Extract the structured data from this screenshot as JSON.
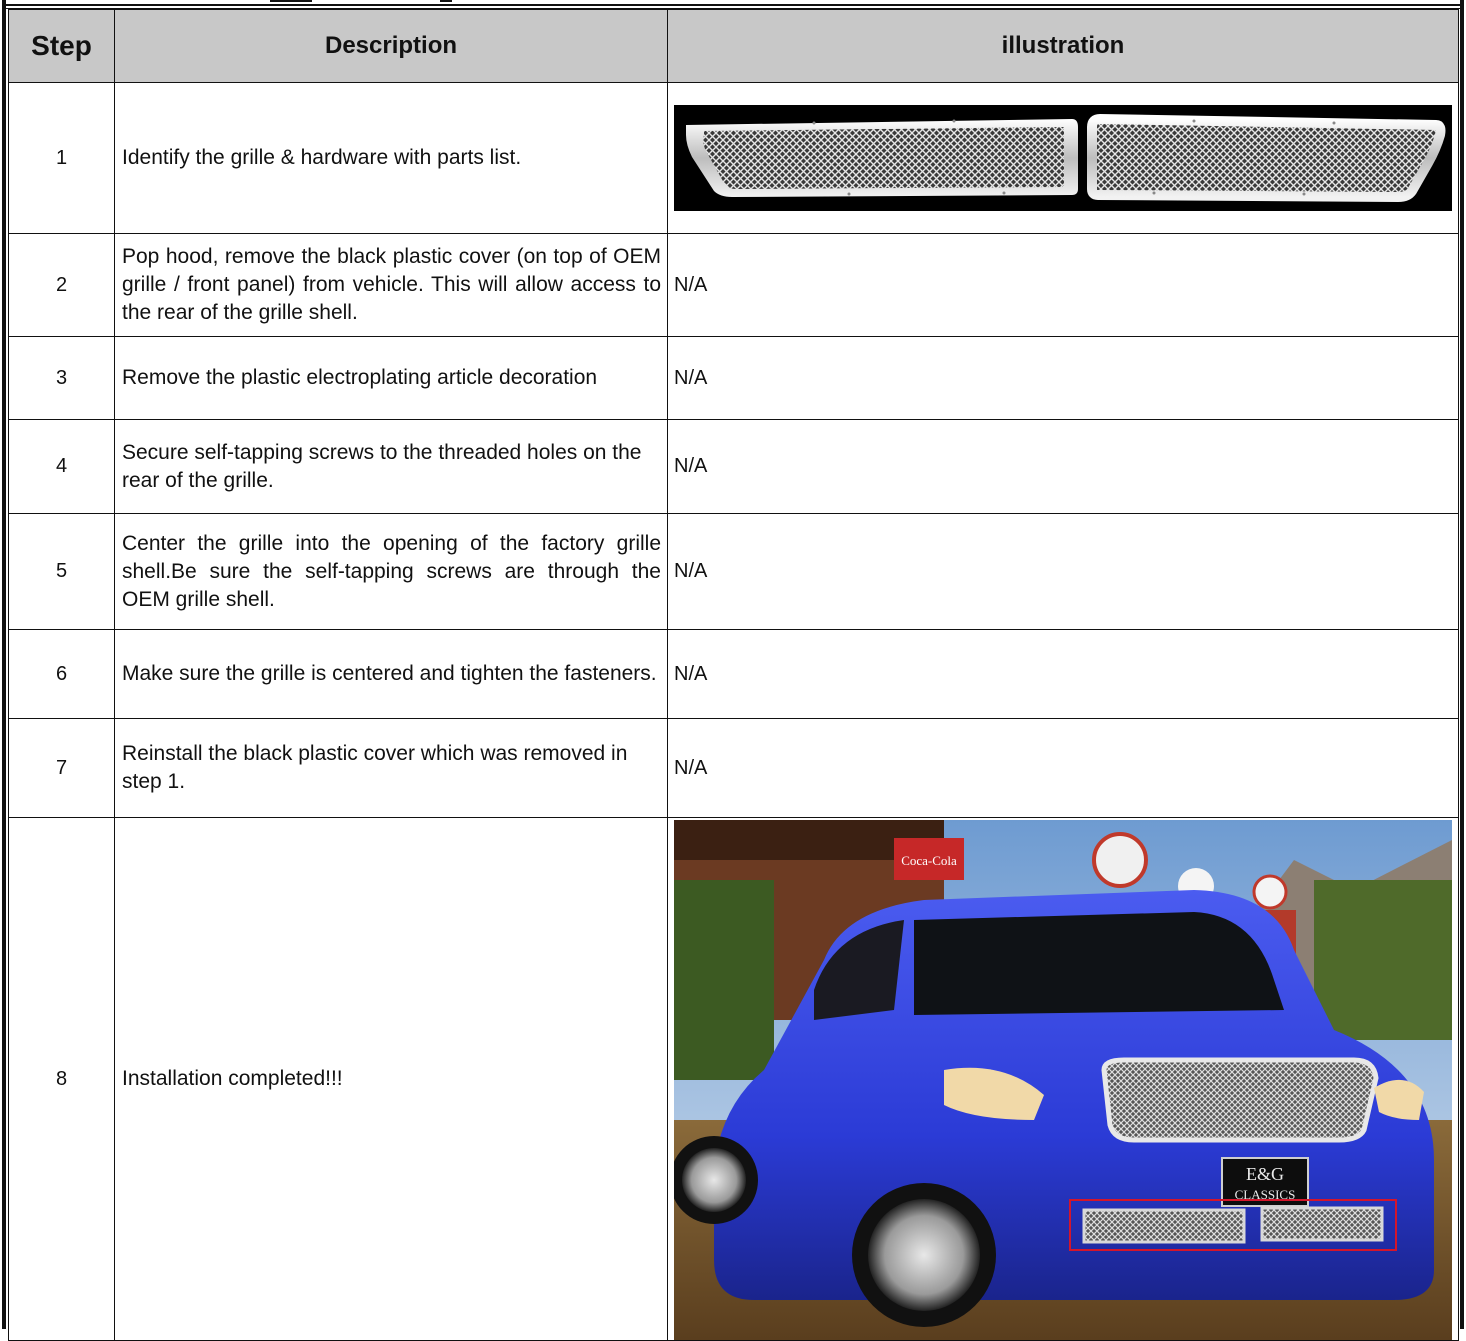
{
  "table": {
    "headers": {
      "step": "Step",
      "description": "Description",
      "illustration": "illustration"
    },
    "rows": [
      {
        "step": "1",
        "description": "Identify the grille & hardware with parts list.",
        "illustration": ""
      },
      {
        "step": "2",
        "description": "Pop hood, remove the black plastic cover (on top of OEM grille / front panel) from vehicle. This will allow access to the rear of the grille shell.",
        "illustration": "N/A"
      },
      {
        "step": "3",
        "description": "Remove the plastic electroplating article decoration",
        "illustration": "N/A"
      },
      {
        "step": "4",
        "description": "Secure self-tapping screws  to the threaded holes on the rear of the grille.",
        "illustration": "N/A"
      },
      {
        "step": "5",
        "description": "Center the grille into the opening of the factory grille shell.Be sure the self-tapping screws are through the OEM grille shell.",
        "illustration": "N/A"
      },
      {
        "step": "6",
        "description": "Make sure the grille is centered and tighten the fasteners.",
        "illustration": "N/A"
      },
      {
        "step": "7",
        "description": "Reinstall the black plastic cover which was removed in step 1.",
        "illustration": "N/A"
      },
      {
        "step": "8",
        "description": "Installation completed!!!",
        "illustration": ""
      }
    ]
  },
  "photo": {
    "brand_line1": "E&G",
    "brand_line2": "CLASSICS",
    "sign_text": "Coca-Cola"
  },
  "colors": {
    "header_bg": "#c8c8c8",
    "car_body": "#2b3bd6",
    "highlight_box": "#d4152b"
  }
}
